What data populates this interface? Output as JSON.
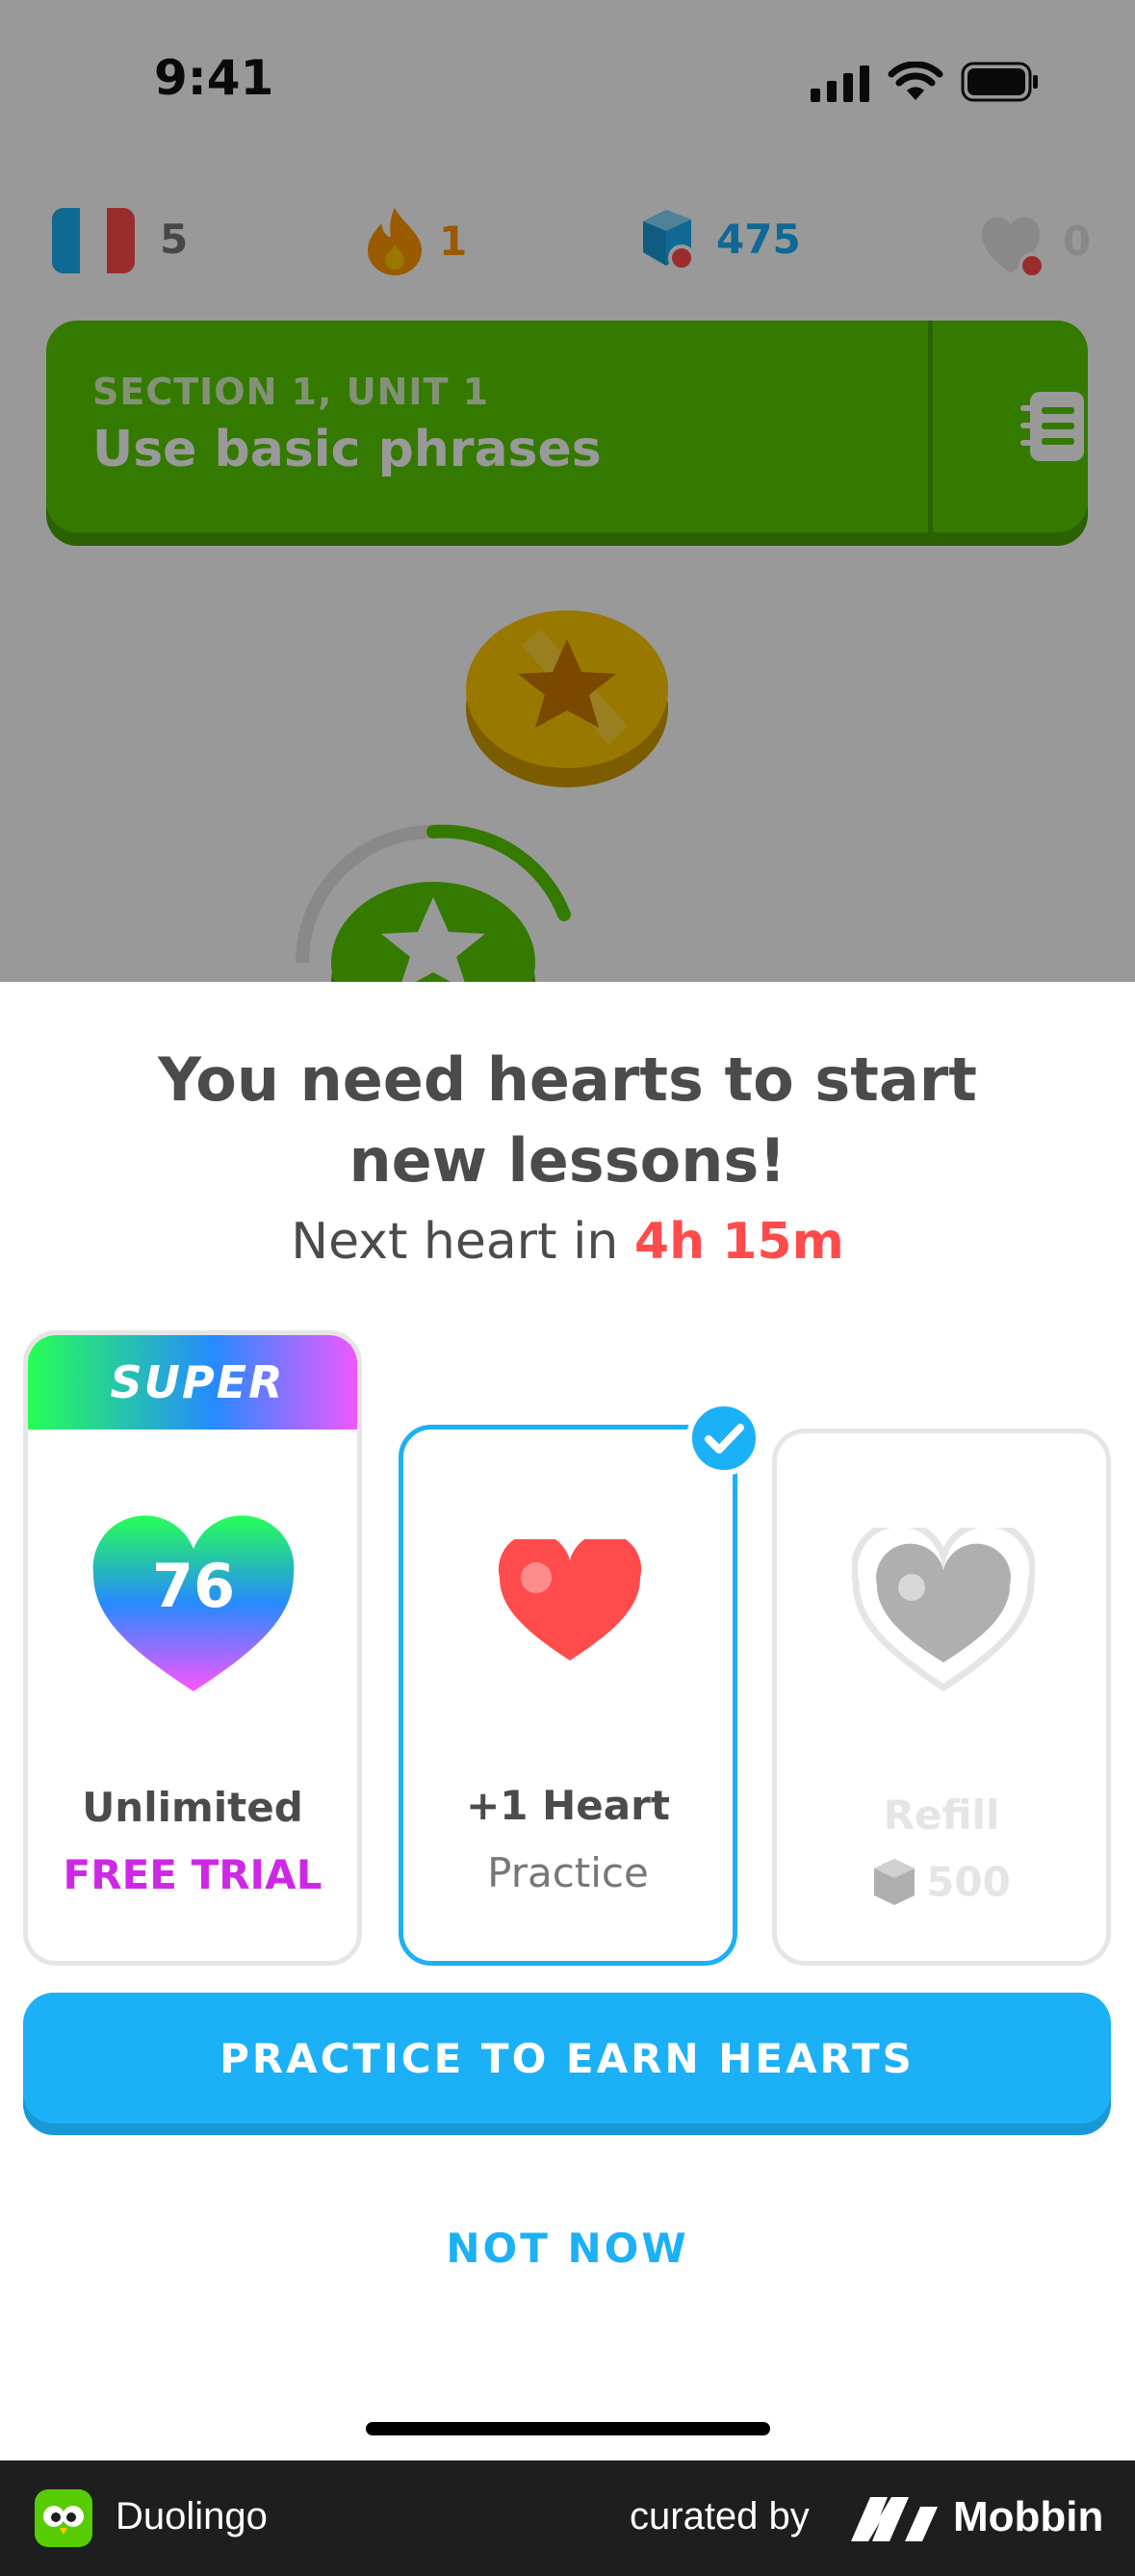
{
  "status_bar": {
    "time": "9:41"
  },
  "stats": {
    "language_count": "5",
    "streak": "1",
    "gems": "475",
    "hearts": "0"
  },
  "unit": {
    "section": "SECTION 1, UNIT 1",
    "title": "Use basic phrases"
  },
  "sheet": {
    "title_line1": "You need hearts to start",
    "title_line2": "new lessons!",
    "next_heart_prefix": "Next heart in ",
    "next_heart_time": "4h 15m"
  },
  "options": [
    {
      "badge": "SUPER",
      "icon_value": "76",
      "title": "Unlimited",
      "subtitle": "FREE TRIAL",
      "selected": false,
      "enabled": true
    },
    {
      "title": "+1 Heart",
      "subtitle": "Practice",
      "selected": true,
      "enabled": true
    },
    {
      "title": "Refill",
      "subtitle": "500",
      "selected": false,
      "enabled": false
    }
  ],
  "buttons": {
    "primary": "PRACTICE TO EARN HEARTS",
    "secondary": "NOT NOW"
  },
  "footer": {
    "app_name": "Duolingo",
    "curated_by": "curated by",
    "brand": "Mobbin"
  },
  "colors": {
    "green": "#58cc02",
    "blue": "#1cb0f6",
    "red": "#ff4b4b",
    "magenta": "#ce28e6",
    "gray_text": "#4b4b4b"
  },
  "icons": [
    "france-flag-icon",
    "streak-flame-icon",
    "gem-icon",
    "heart-icon",
    "guidebook-icon",
    "star-icon",
    "checkmark-icon"
  ]
}
